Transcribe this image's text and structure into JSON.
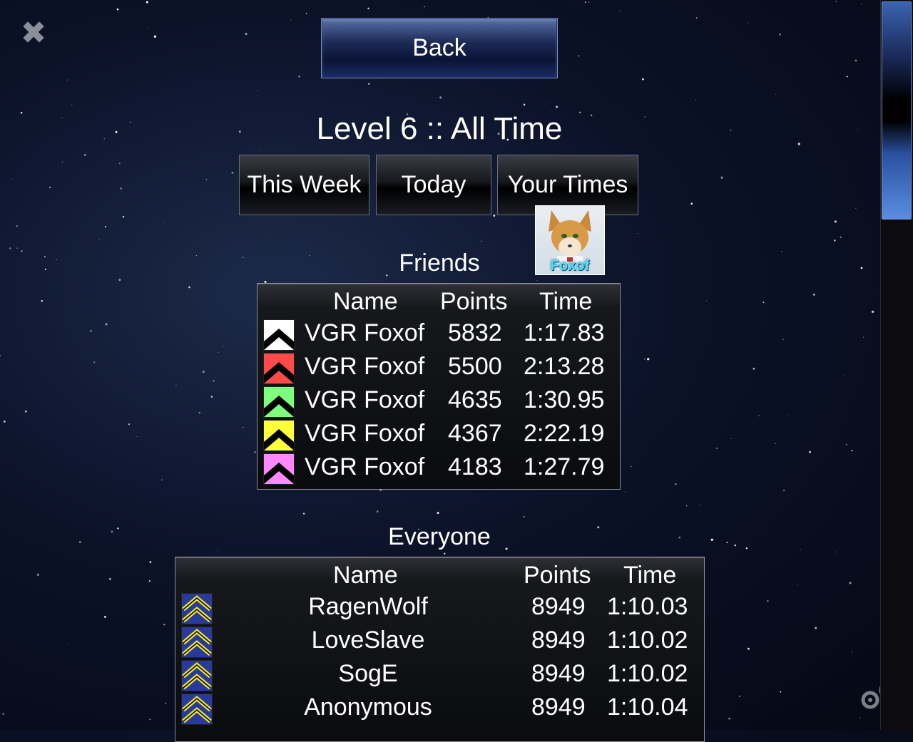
{
  "header": {
    "back_label": "Back",
    "title": "Level 6 :: All Time"
  },
  "tabs": [
    {
      "label": "This Week"
    },
    {
      "label": "Today"
    },
    {
      "label": "Your Times"
    }
  ],
  "avatar": {
    "label": "Foxof"
  },
  "friends": {
    "section_label": "Friends",
    "columns": {
      "name": "Name",
      "points": "Points",
      "time": "Time"
    },
    "rows": [
      {
        "rank_color": "#ffffff",
        "name": "VGR Foxof",
        "points": "5832",
        "time": "1:17.83"
      },
      {
        "rank_color": "#ff4a4a",
        "name": "VGR Foxof",
        "points": "5500",
        "time": "2:13.28"
      },
      {
        "rank_color": "#7dff7d",
        "name": "VGR Foxof",
        "points": "4635",
        "time": "1:30.95"
      },
      {
        "rank_color": "#ffff3c",
        "name": "VGR Foxof",
        "points": "4367",
        "time": "2:22.19"
      },
      {
        "rank_color": "#ff88ff",
        "name": "VGR Foxof",
        "points": "4183",
        "time": "1:27.79"
      }
    ]
  },
  "everyone": {
    "section_label": "Everyone",
    "columns": {
      "name": "Name",
      "points": "Points",
      "time": "Time"
    },
    "rows": [
      {
        "name": "RagenWolf",
        "points": "8949",
        "time": "1:10.03"
      },
      {
        "name": "LoveSlave",
        "points": "8949",
        "time": "1:10.02"
      },
      {
        "name": "SogE",
        "points": "8949",
        "time": "1:10.02"
      },
      {
        "name": "Anonymous",
        "points": "8949",
        "time": "1:10.04"
      }
    ]
  },
  "icons": {
    "close": "close-icon",
    "settings": "gears-icon",
    "rank_badge": "chevron-rank-icon"
  },
  "colors": {
    "accent_blue": "#1c2a56",
    "scroll_thumb": "#3a64b0",
    "chevron_yellow": "#f0e830",
    "chevron_blue": "#2a3a9a"
  }
}
